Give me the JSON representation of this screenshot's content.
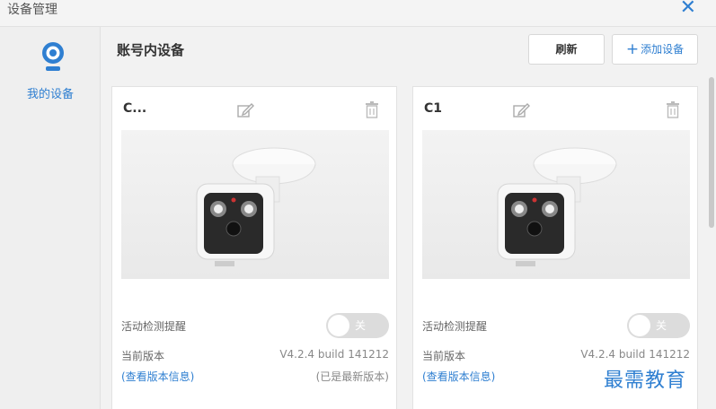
{
  "window": {
    "title": "设备管理",
    "close_glyph": "✕"
  },
  "sidebar": {
    "items": [
      {
        "label": "我的设备",
        "icon": "camera-icon"
      }
    ]
  },
  "main": {
    "title": "账号内设备",
    "refresh_label": "刷新",
    "add_label": "添加设备",
    "add_icon_glyph": "+"
  },
  "devices": [
    {
      "name": "C...",
      "motion_label": "活动检测提醒",
      "motion_state": "关",
      "version_label": "当前版本",
      "version_value": "V4.2.4 build 141212",
      "info_link": "(查看版本信息)",
      "info_status": "(已是最新版本)"
    },
    {
      "name": "C1",
      "motion_label": "活动检测提醒",
      "motion_state": "关",
      "version_label": "当前版本",
      "version_value": "V4.2.4 build 141212",
      "info_link": "(查看版本信息)",
      "info_status": ""
    }
  ],
  "watermark": "最需教育",
  "colors": {
    "accent": "#2f7fd1",
    "toggle_off": "#dcdcdc"
  }
}
